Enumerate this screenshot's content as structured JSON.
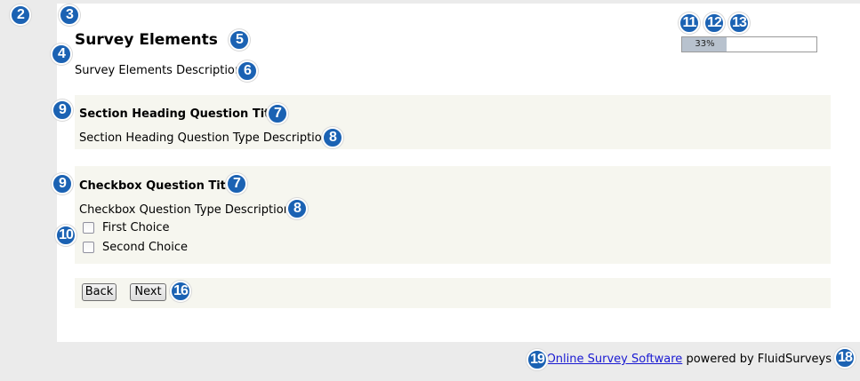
{
  "survey": {
    "title": "Survey Elements",
    "description": "Survey Elements Description"
  },
  "progress": {
    "value": 0.33,
    "label": "33%"
  },
  "sections": [
    {
      "title": "Section Heading Question Title",
      "description": "Section Heading Question Type Description"
    },
    {
      "title": "Checkbox Question Title",
      "description": "Checkbox Question Type Description",
      "choices": [
        "First Choice",
        "Second Choice"
      ]
    }
  ],
  "nav": {
    "back_label": "Back",
    "next_label": "Next"
  },
  "footer": {
    "link_text": "Online Survey Software",
    "powered_text": "powered by FluidSurveys"
  },
  "badges": {
    "b2": "2",
    "b3": "3",
    "b4": "4",
    "b5": "5",
    "b6": "6",
    "b7a": "7",
    "b7b": "7",
    "b8a": "8",
    "b8b": "8",
    "b9a": "9",
    "b9b": "9",
    "b10": "10",
    "b11": "11",
    "b12": "12",
    "b13": "13",
    "b16": "16",
    "b18": "18",
    "b19": "19"
  },
  "colors": {
    "badge": "#1b62b3",
    "page_background": "#ebebeb",
    "section_background": "#f6f6ef",
    "progress_fill": "#b8c2ce",
    "link": "#1a1ad2"
  }
}
